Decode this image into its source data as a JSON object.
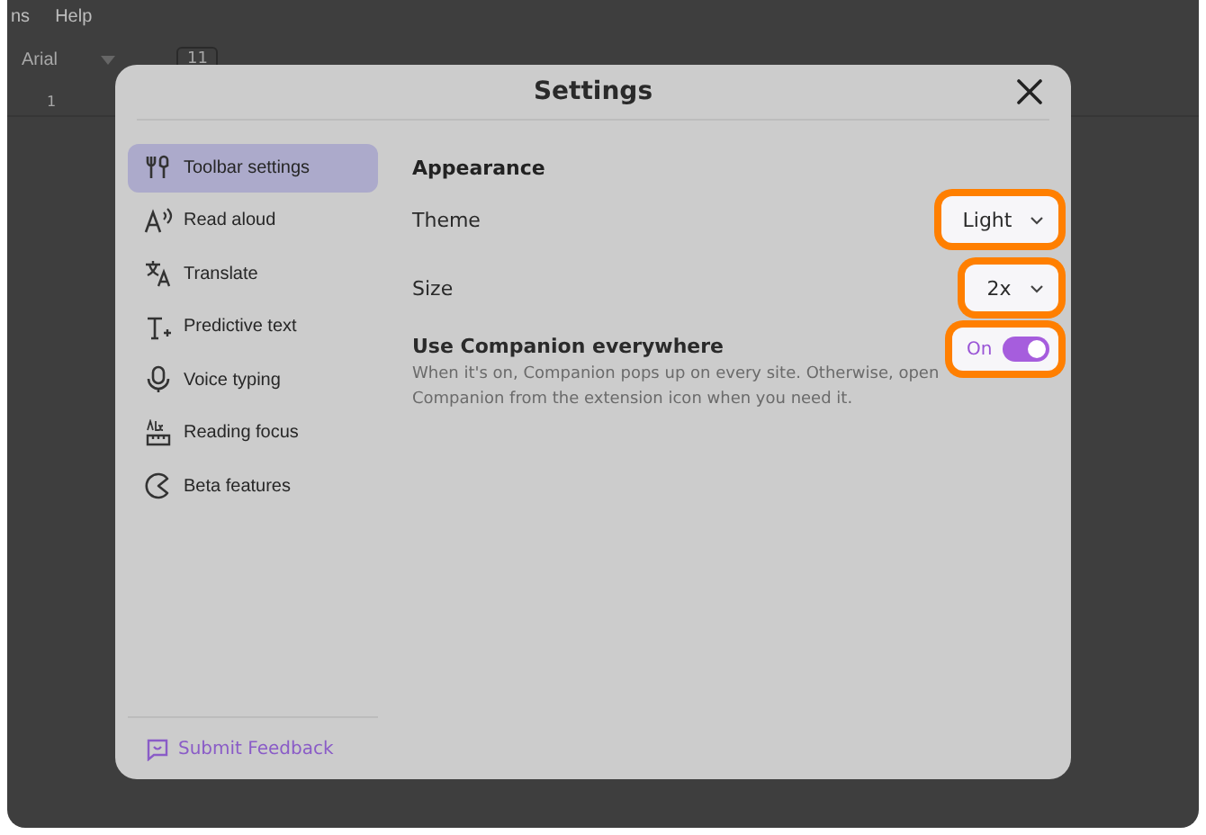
{
  "background_app": {
    "menu": [
      "ns",
      "Help"
    ],
    "font": "Arial",
    "font_size": "11",
    "ruler_mark": "1"
  },
  "dialog": {
    "title": "Settings",
    "sidebar": {
      "items": [
        {
          "label": "Toolbar settings",
          "selected": true
        },
        {
          "label": "Read aloud",
          "selected": false
        },
        {
          "label": "Translate",
          "selected": false
        },
        {
          "label": "Predictive text",
          "selected": false
        },
        {
          "label": "Voice typing",
          "selected": false
        },
        {
          "label": "Reading focus",
          "selected": false
        },
        {
          "label": "Beta features",
          "selected": false
        }
      ],
      "feedback": "Submit Feedback"
    },
    "content": {
      "section": "Appearance",
      "settings": [
        {
          "kind": "select",
          "label": "Theme",
          "value": "Light",
          "highlighted": true
        },
        {
          "kind": "select",
          "label": "Size",
          "value": "2x",
          "highlighted": true
        },
        {
          "kind": "toggle",
          "label": "Use Companion everywhere",
          "description": "When it's on, Companion pops up on every site. Otherwise, open Companion from the extension icon when you need it.",
          "state_label": "On",
          "on": true,
          "highlighted": true
        }
      ]
    }
  }
}
